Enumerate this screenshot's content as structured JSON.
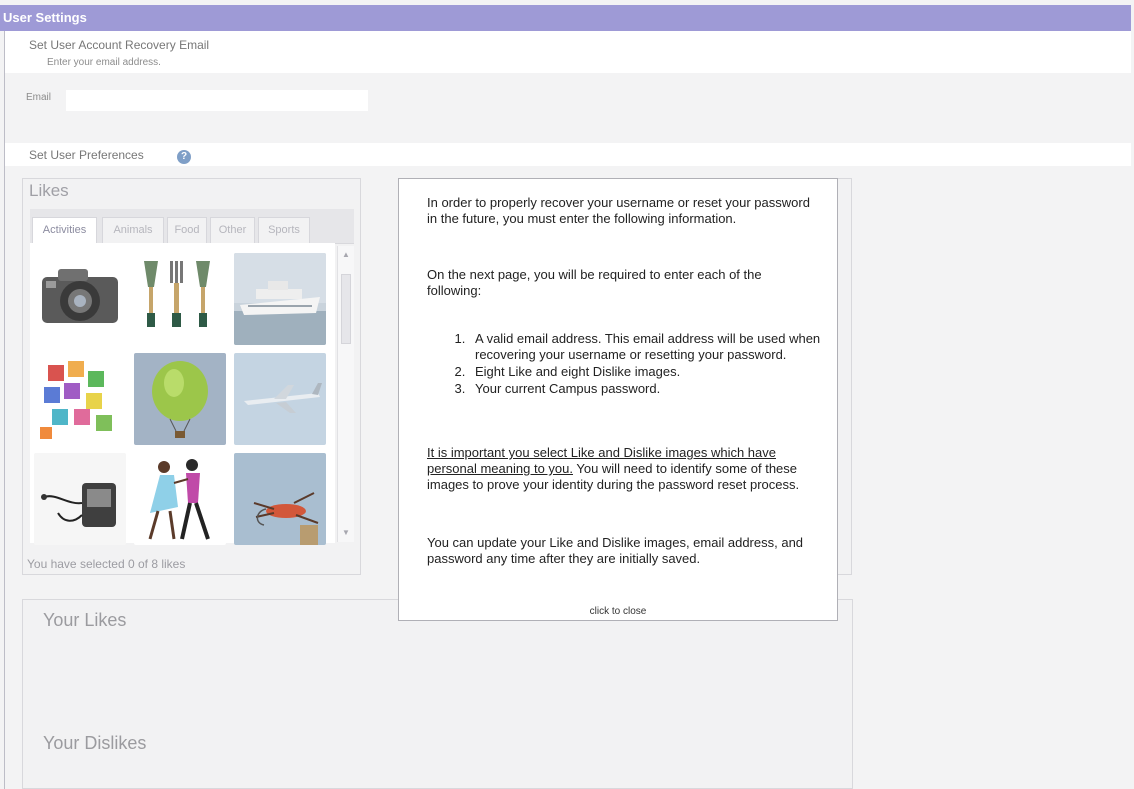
{
  "header": {
    "title": "User Settings"
  },
  "recovery": {
    "title": "Set User Account Recovery Email",
    "instruction": "Enter your email address.",
    "email_label": "Email",
    "email_value": ""
  },
  "preferences": {
    "title": "Set User Preferences",
    "help_icon": "help-icon"
  },
  "likes_panel": {
    "title": "Likes",
    "tabs": [
      "Activities",
      "Animals",
      "Food",
      "Other",
      "Sports"
    ],
    "active_tab": "Activities",
    "status": "You have selected 0 of 8 likes",
    "images": [
      "camera",
      "garden-tools",
      "cruise-ship",
      "jigsaw-puzzle",
      "hot-air-balloon",
      "airplane",
      "cassette-player",
      "dancers",
      "fishing-fly"
    ]
  },
  "your_likes": {
    "title": "Your Likes"
  },
  "your_dislikes": {
    "title": "Your Dislikes"
  },
  "modal": {
    "para1": "In order to properly recover your username or reset your password in the future, you must enter the following information.",
    "para2": "On the next page, you will be required to enter each of the following:",
    "items": [
      "A valid email address. This email address will be used when recovering your username or resetting your password.",
      "Eight Like and eight Dislike images.",
      "Your current Campus password."
    ],
    "para3_underlined": "It is important you select Like and Dislike images which have personal meaning to you.",
    "para3_rest": " You will need to identify some of these images to prove your identity during the password reset process.",
    "para4": "You can update your Like and Dislike images, email address, and password any time after they are initially saved.",
    "close_label": "click to close"
  },
  "colors": {
    "header_bg": "#9e9ad6",
    "help_icon": "#7f9fc7"
  }
}
